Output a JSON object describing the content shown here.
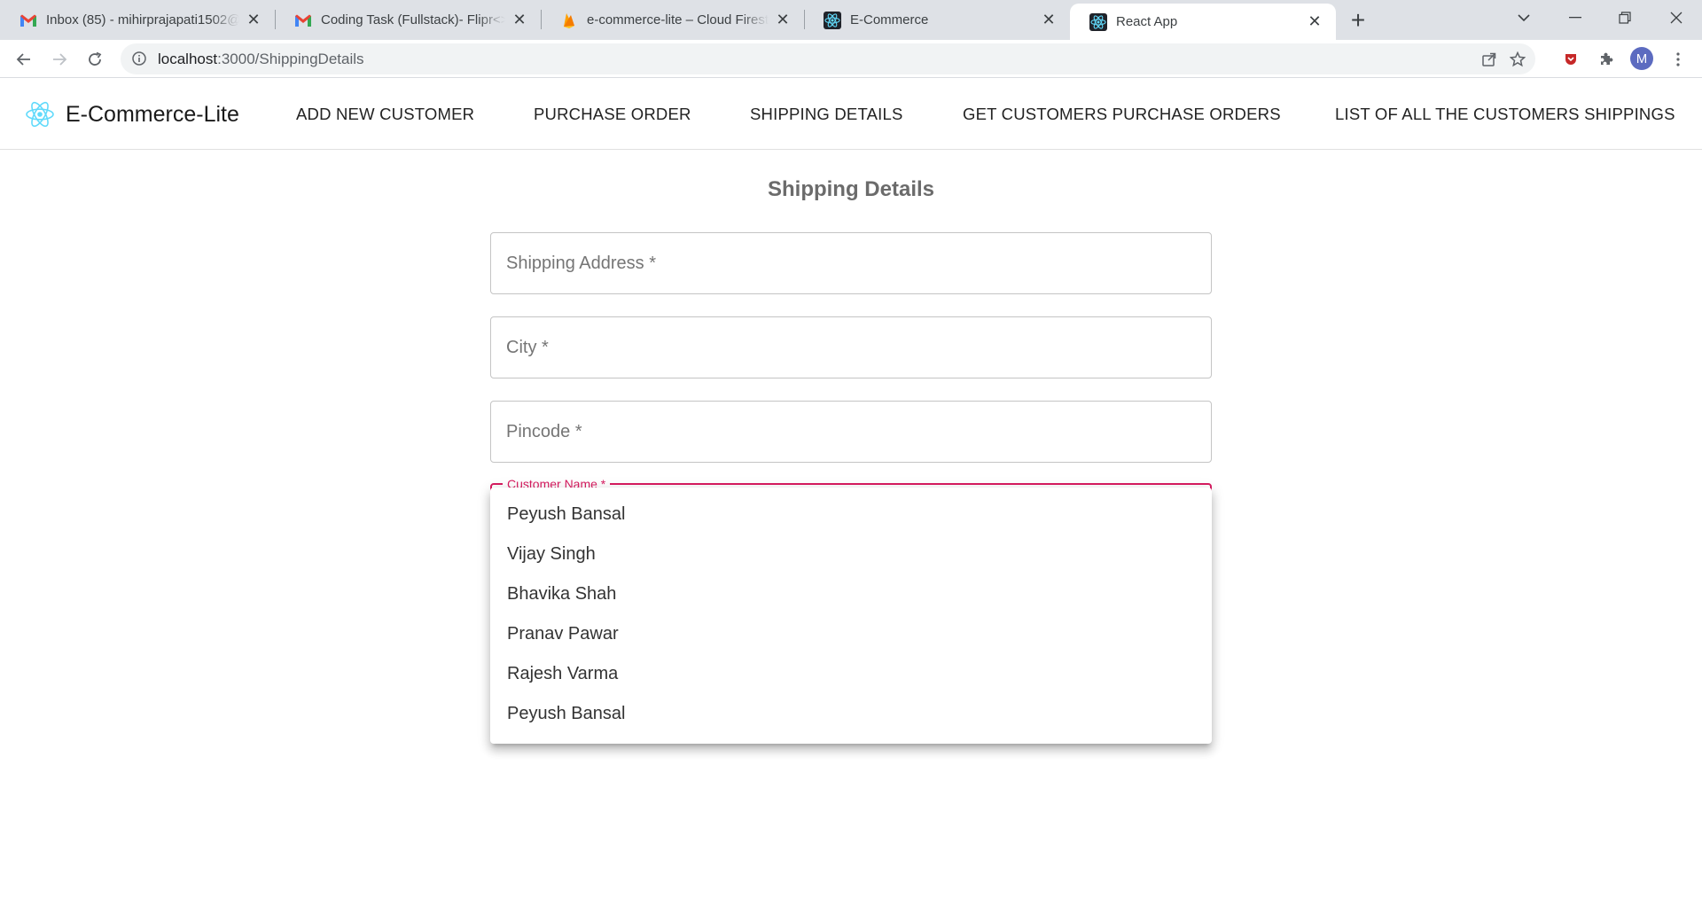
{
  "browser": {
    "tabs": [
      {
        "title": "Inbox (85) - mihirprajapati1502@",
        "favicon": "gmail-icon",
        "active": false
      },
      {
        "title": "Coding Task (Fullstack)- Flipr<> E",
        "favicon": "gmail-icon",
        "active": false
      },
      {
        "title": "e-commerce-lite – Cloud Firestor",
        "favicon": "firebase-icon",
        "active": false
      },
      {
        "title": "E-Commerce",
        "favicon": "react-icon",
        "active": false
      },
      {
        "title": "React App",
        "favicon": "react-icon",
        "active": true
      }
    ],
    "new_tab_label": "+",
    "address": {
      "host": "localhost",
      "path": ":3000/ShippingDetails"
    },
    "profile_initial": "M"
  },
  "appbar": {
    "brand": "E-Commerce-Lite",
    "nav": [
      "ADD NEW CUSTOMER",
      "PURCHASE ORDER",
      "SHIPPING DETAILS",
      "GET CUSTOMERS PURCHASE ORDERS",
      "LIST OF ALL THE CUSTOMERS SHIPPINGS"
    ]
  },
  "form": {
    "title": "Shipping Details",
    "shipping_address_placeholder": "Shipping Address *",
    "city_placeholder": "City *",
    "pincode_placeholder": "Pincode *",
    "customer_name_label": "Customer Name *"
  },
  "dropdown": {
    "options": [
      "Peyush Bansal",
      "Vijay Singh",
      "Bhavika Shah",
      "Pranav Pawar",
      "Rajesh Varma",
      "Peyush Bansal"
    ]
  },
  "colors": {
    "accent": "#d81b60",
    "react_blue": "#61dafb",
    "profile": "#5c6bc0"
  }
}
